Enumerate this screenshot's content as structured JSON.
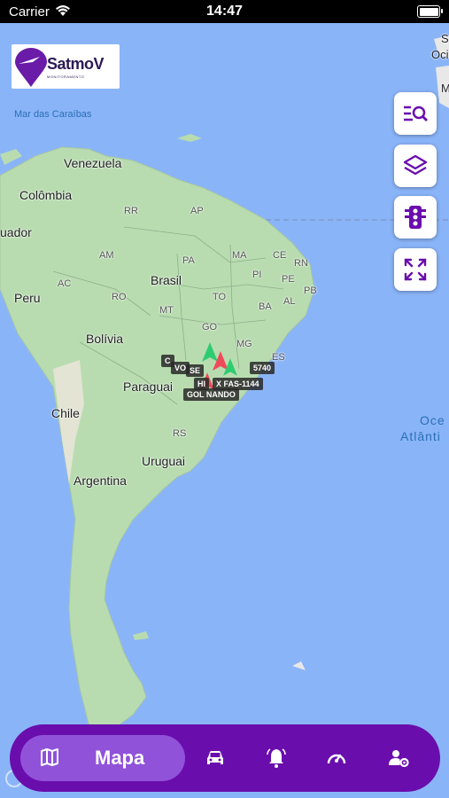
{
  "status_bar": {
    "carrier": "Carrier",
    "time": "14:47"
  },
  "logo": {
    "name": "SatmoV",
    "tagline": "MONITORAMENTO"
  },
  "map_labels": {
    "countries": [
      "Venezuela",
      "Colômbia",
      "Brasil",
      "Peru",
      "Bolívia",
      "Paraguai",
      "Chile",
      "Uruguai",
      "Argentina"
    ],
    "equador_partial": "uador",
    "states": [
      "RR",
      "AP",
      "AM",
      "PA",
      "MA",
      "CE",
      "RN",
      "PI",
      "PB",
      "AC",
      "RO",
      "TO",
      "PE",
      "AL",
      "MT",
      "BA",
      "GO",
      "MG",
      "ES",
      "RS"
    ],
    "caribbean": "Mar das Caraíbas",
    "atlantic": "Oceano Atlântico",
    "atlantic_line1": "Oce",
    "atlantic_line2": "Atlânti",
    "top_right_1": "S",
    "top_right_2": "Oci",
    "top_right_3": "M"
  },
  "vehicles": {
    "labels": [
      "C",
      "VO",
      "SE",
      "5740",
      "HI",
      "X FAS-1144",
      "GOL NANDO"
    ]
  },
  "tools": {
    "icons": [
      "search-list-icon",
      "layers-icon",
      "traffic-light-icon",
      "fullscreen-icon"
    ]
  },
  "bottom_nav": {
    "active_label": "Mapa",
    "icons": [
      "map-icon",
      "car-icon",
      "bell-icon",
      "speedometer-icon",
      "user-settings-icon"
    ]
  },
  "colors": {
    "brand": "#6a0dad",
    "active": "#9052d9",
    "ocean": "#8ab4f8",
    "land": "#b8dcb0"
  }
}
